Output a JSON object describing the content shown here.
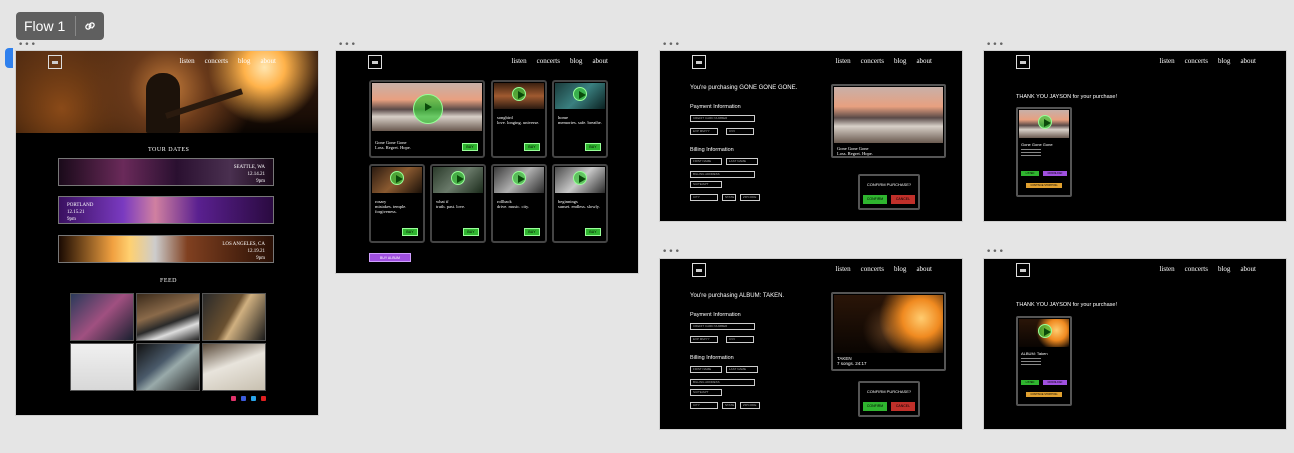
{
  "flow": {
    "label": "Flow 1"
  },
  "colors": {
    "canvas": "#e5e5e5",
    "frame": "#000000",
    "accent_green": "#2fb52f",
    "accent_purple": "#a050e0",
    "cancel_red": "#c0302a",
    "selection_blue": "#2f80ed"
  },
  "nav": [
    "listen",
    "concerts",
    "blog",
    "about"
  ],
  "home": {
    "tour_title": "TOUR DATES",
    "tours": [
      {
        "city": "SEATTLE, WA",
        "date": "12.14.21",
        "time": "9pm"
      },
      {
        "city": "PORTLAND",
        "date": "12.15.21",
        "time": "9pm"
      },
      {
        "city": "LOS ANGELES, CA",
        "date": "12.19.21",
        "time": "9pm"
      }
    ],
    "feed_title": "FEED"
  },
  "listen": {
    "items": [
      {
        "title": "Gone Gone Gone",
        "sub": "Loss. Regret. Hope."
      },
      {
        "title": "songbird",
        "sub": "love. longing. universe."
      },
      {
        "title": "home",
        "sub": "memories. safe. breathe."
      },
      {
        "title": "rosary",
        "sub": "mistakes. temple. forgiveness."
      },
      {
        "title": "what if",
        "sub": "truth. past. love."
      },
      {
        "title": "rollback",
        "sub": "drive. music. city."
      },
      {
        "title": "beginnings",
        "sub": "sunset. endless. slowly."
      }
    ],
    "buy_label": "BUY",
    "buy_album": "BUY ALBUM"
  },
  "checkout1": {
    "title": "You're purchasing GONE GONE GONE.",
    "product": "Gone Gone Gone",
    "product_sub": "Loss. Regret. Hope."
  },
  "checkout2": {
    "title": "You're purchasing ALBUM: TAKEN.",
    "product": "TAKEN",
    "product_sub": "7 songs. 24:17"
  },
  "form": {
    "payment": "Payment Information",
    "billing": "Billing Information",
    "card": "CREDIT CARD NUMBER",
    "exp": "EXP MM/YY",
    "cvv": "CVV",
    "first": "FIRST NAME",
    "last": "LAST NAME",
    "billing_address": "BILLING ADDRESS",
    "apt": "SUITE/APT",
    "city": "CITY",
    "state": "STATE",
    "zip": "ZIPCODE",
    "confirm_title": "CONFIRM PURCHASE?",
    "confirm": "CONFIRM",
    "cancel": "CANCEL"
  },
  "thanks1": {
    "title": "THANK YOU JAYSON for your purchase!",
    "product": "Gone Gone Gone"
  },
  "thanks2": {
    "title": "THANK YOU JAYSON for your purchase!",
    "product": "ALBUM: Taken"
  },
  "thanks_buttons": {
    "a": "LISTEN",
    "b": "DOWNLOAD",
    "c": "CONTINUE SHOPPING"
  }
}
